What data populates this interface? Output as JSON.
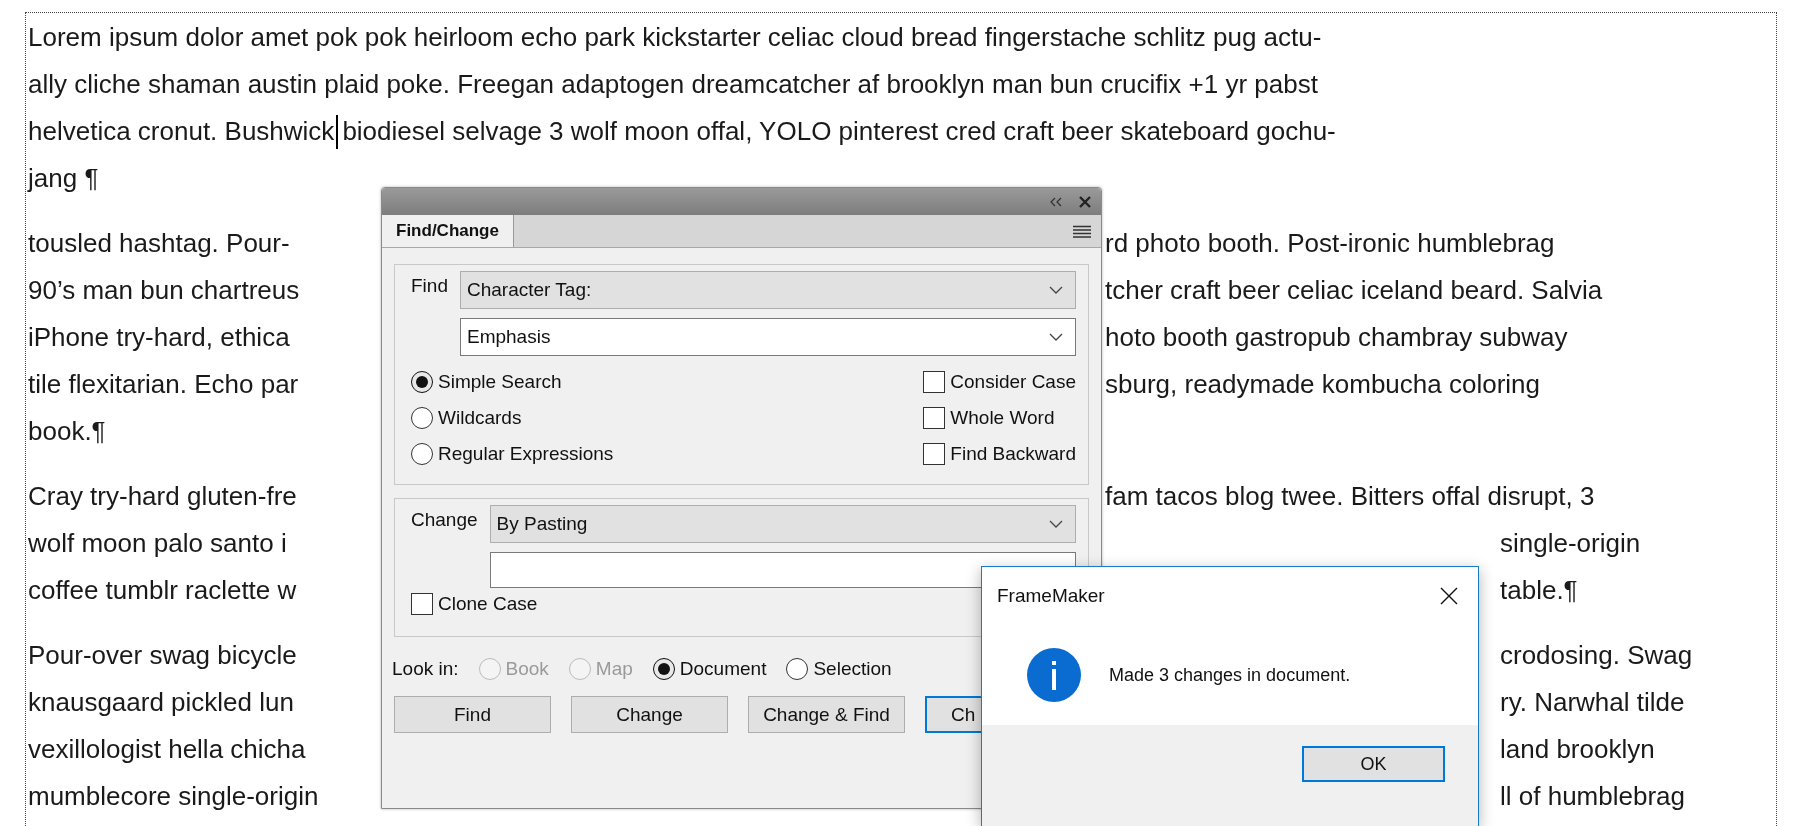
{
  "document": {
    "paragraphs": [
      {
        "lines": [
          {
            "left": "Lorem ipsum dolor amet pok pok heirloom echo park kickstarter celiac cloud bread fingerstache schlitz pug actu-",
            "cursor": false
          },
          {
            "left": "ally cliche shaman austin plaid poke. Freegan adaptogen dreamcatcher af brooklyn man bun crucifix +1 yr pabst",
            "cursor": false
          },
          {
            "left": "helvetica cronut. Bushwick",
            "cursor": true,
            "after_cursor": "biodiesel selvage 3 wolf moon offal, YOLO pinterest cred craft beer skateboard gochu-"
          },
          {
            "left": "jang ¶",
            "cursor": false
          }
        ]
      },
      {
        "lines": [
          {
            "left": "tousled hashtag. Pour-",
            "right_of_panel": "rd photo booth. Post-ironic humblebrag",
            "cursor": false
          },
          {
            "left": "90’s man bun chartreus",
            "right_of_panel": "tcher craft beer celiac iceland beard. Salvia",
            "cursor": false
          },
          {
            "left": "iPhone try-hard, ethica",
            "right_of_panel": "hoto booth gastropub chambray subway",
            "cursor": false
          },
          {
            "left": "tile flexitarian. Echo par",
            "right_of_panel": "sburg, readymade kombucha coloring",
            "cursor": false
          },
          {
            "left": "book.¶",
            "cursor": false
          }
        ]
      },
      {
        "lines": [
          {
            "left": "Cray try-hard gluten-fre",
            "right_of_panel": "fam tacos blog twee. Bitters offal disrupt, 3",
            "cursor": false
          },
          {
            "left": "wolf moon palo santo i",
            "right_of_message": "single-origin",
            "cursor": false
          },
          {
            "left": "coffee tumblr raclette w",
            "right_of_message": "table.¶",
            "cursor": false
          }
        ]
      },
      {
        "lines": [
          {
            "left": "Pour-over swag bicycle",
            "right_of_message": "crodosing. Swag",
            "cursor": false
          },
          {
            "left": "knausgaard pickled lun",
            "right_of_message": "ry. Narwhal tilde",
            "cursor": false
          },
          {
            "left": "vexillologist hella chicha",
            "right_of_message": "land brooklyn",
            "cursor": false
          },
          {
            "left": "mumblecore single-origin",
            "right_of_message": "ll of humblebrag",
            "cursor": false
          }
        ]
      }
    ]
  },
  "find_change_panel": {
    "tab": {
      "label": "Find/Change",
      "selected": true
    },
    "find": {
      "label": "Find",
      "type": "Character Tag:",
      "value": "Emphasis"
    },
    "search_modes": [
      {
        "label": "Simple Search",
        "selected": true
      },
      {
        "label": "Wildcards",
        "selected": false
      },
      {
        "label": "Regular Expressions",
        "selected": false
      }
    ],
    "options": [
      {
        "label": "Consider Case",
        "checked": false
      },
      {
        "label": "Whole Word",
        "checked": false
      },
      {
        "label": "Find Backward",
        "checked": false
      }
    ],
    "change": {
      "label": "Change",
      "mode": "By Pasting",
      "clone_case": {
        "label": "Clone Case",
        "checked": false
      }
    },
    "look_in": {
      "label": "Look in:",
      "scopes": [
        {
          "label": "Book",
          "selected": false,
          "disabled": true
        },
        {
          "label": "Map",
          "selected": false,
          "disabled": true
        },
        {
          "label": "Document",
          "selected": true,
          "disabled": false
        },
        {
          "label": "Selection",
          "selected": false,
          "disabled": false
        }
      ]
    },
    "buttons": [
      {
        "label": "Find",
        "focused": false
      },
      {
        "label": "Change",
        "focused": false
      },
      {
        "label": "Change & Find",
        "focused": false
      },
      {
        "label": "Ch",
        "focused": true
      }
    ]
  },
  "message_box": {
    "title": "FrameMaker",
    "message": "Made 3 changes in document.",
    "buttons": [
      {
        "label": "OK",
        "focused": true
      }
    ]
  }
}
